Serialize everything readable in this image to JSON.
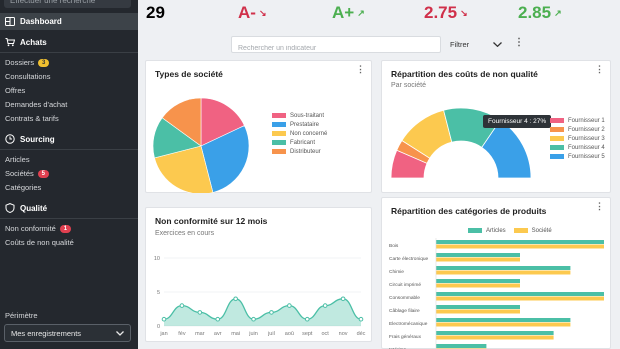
{
  "sidebar": {
    "search_placeholder": "Effectuer une recherche",
    "dashboard_label": "Dashboard",
    "sections": [
      {
        "label": "Achats",
        "icon": "cart-icon",
        "items": [
          {
            "label": "Dossiers",
            "badge": "3",
            "badge_color": "yellow"
          },
          {
            "label": "Consultations"
          },
          {
            "label": "Offres"
          },
          {
            "label": "Demandes d'achat"
          },
          {
            "label": "Contrats & tarifs"
          }
        ]
      },
      {
        "label": "Sourcing",
        "icon": "clock-icon",
        "items": [
          {
            "label": "Articles"
          },
          {
            "label": "Sociétés",
            "badge": "5",
            "badge_color": "red"
          },
          {
            "label": "Catégories"
          }
        ]
      },
      {
        "label": "Qualité",
        "icon": "shield-icon",
        "items": [
          {
            "label": "Non conformité",
            "badge": "1",
            "badge_color": "red"
          },
          {
            "label": "Coûts de non qualité"
          }
        ]
      }
    ],
    "perimetre_label": "Périmètre",
    "perimetre_value": "Mes enregistrements"
  },
  "kpis": [
    {
      "value": "29",
      "color": "#222222",
      "arrow": ""
    },
    {
      "value": "A-",
      "color": "#d0304a",
      "arrow": "↘"
    },
    {
      "value": "A+",
      "color": "#4caf50",
      "arrow": "↗"
    },
    {
      "value": "2.75",
      "color": "#d0304a",
      "arrow": "↘"
    },
    {
      "value": "2.85",
      "color": "#4caf50",
      "arrow": "↗"
    }
  ],
  "toolbar": {
    "search_placeholder": "Rechercher un indicateur",
    "filter_label": "Filtrer"
  },
  "cards": {
    "types": {
      "title": "Types de société",
      "chart_data": {
        "type": "pie",
        "categories": [
          "Sous-traitant",
          "Prestataire",
          "Non concerné",
          "Fabricant",
          "Distributeur"
        ],
        "values": [
          18,
          28,
          25,
          14,
          15
        ],
        "colors": [
          "#f06282",
          "#3aa0e8",
          "#fcc94f",
          "#4bbfa6",
          "#f7934c"
        ]
      }
    },
    "couts": {
      "title": "Répartition des coûts de non qualité",
      "subtitle": "Par société",
      "tooltip": "Fournisseur 4 : 27%",
      "chart_data": {
        "type": "pie",
        "categories": [
          "Fournisseur 1",
          "Fournisseur 2",
          "Fournisseur 3",
          "Fournisseur 4",
          "Fournisseur 5"
        ],
        "values": [
          13,
          5,
          24,
          27,
          31
        ],
        "colors": [
          "#f06282",
          "#f7934c",
          "#fcc94f",
          "#4bbfa6",
          "#3aa0e8"
        ]
      }
    },
    "nonconf": {
      "title": "Non conformité sur 12 mois",
      "subtitle": "Exercices en cours",
      "chart_data": {
        "type": "area",
        "x": [
          "jan",
          "fév",
          "mar",
          "avr",
          "mai",
          "juin",
          "juil",
          "aoû",
          "sept",
          "oct",
          "nov",
          "déc"
        ],
        "values": [
          1,
          3,
          2,
          1,
          4,
          1,
          2,
          3,
          1,
          3,
          4,
          1
        ],
        "ylim": [
          0,
          10
        ],
        "yticks": [
          0,
          5,
          10
        ],
        "color": "#4bbfa6"
      }
    },
    "categories": {
      "title": "Répartition des catégories de produits",
      "chart_data": {
        "type": "bar",
        "orientation": "horizontal",
        "categories": [
          "Bois",
          "Carte électronique",
          "Chimie",
          "Circuit imprimé",
          "Consommable",
          "Câblage filaire",
          "Electromécanique",
          "Frais généraux",
          "Intérims"
        ],
        "series": [
          {
            "name": "Articles",
            "color": "#4bbfa6",
            "values": [
              10,
              5,
              8,
              5,
              10,
              5,
              8,
              7,
              3
            ]
          },
          {
            "name": "Société",
            "color": "#fcc94f",
            "values": [
              10,
              5,
              8,
              5,
              10,
              5,
              8,
              7,
              3
            ]
          }
        ]
      }
    }
  }
}
